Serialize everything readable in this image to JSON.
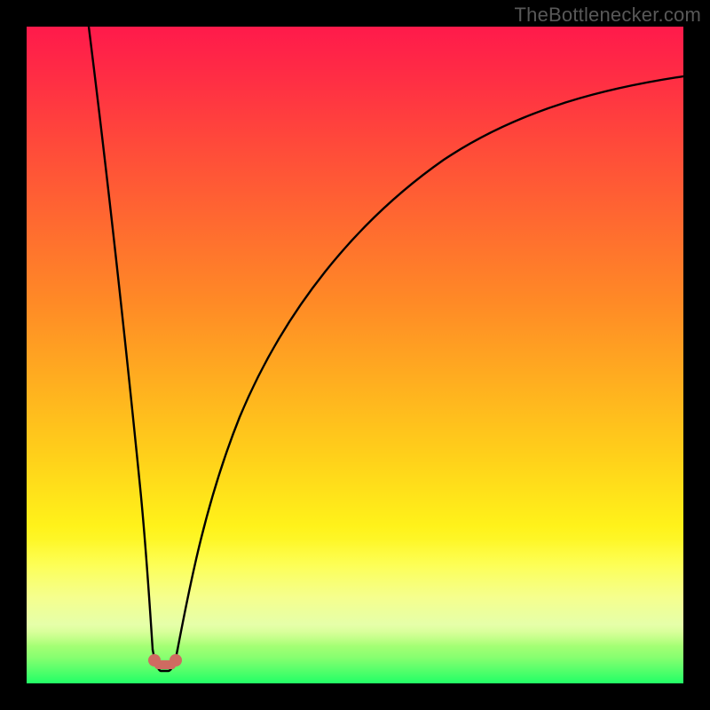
{
  "watermark": {
    "text": "TheBottlenecker.com"
  },
  "chart_data": {
    "type": "line",
    "title": "",
    "xlabel": "",
    "ylabel": "",
    "xlim": [
      0,
      100
    ],
    "ylim": [
      0,
      100
    ],
    "legend": false,
    "grid": false,
    "annotations": [],
    "background_gradient": {
      "direction": "vertical",
      "stops": [
        {
          "pct": 0,
          "color": "#ff1a4b"
        },
        {
          "pct": 50,
          "color": "#ffa81f"
        },
        {
          "pct": 78,
          "color": "#fff21a"
        },
        {
          "pct": 100,
          "color": "#22ff66"
        }
      ]
    },
    "curve": {
      "description": "V / cusp shaped bottleneck curve; minimum near x≈20 at y≈0",
      "min_x": 20,
      "min_y": 0,
      "points": [
        {
          "x": 9.5,
          "y": 100
        },
        {
          "x": 12,
          "y": 75
        },
        {
          "x": 14,
          "y": 55
        },
        {
          "x": 16,
          "y": 35
        },
        {
          "x": 17.5,
          "y": 18
        },
        {
          "x": 18.7,
          "y": 6
        },
        {
          "x": 19.5,
          "y": 1.5
        },
        {
          "x": 20.5,
          "y": 0.8
        },
        {
          "x": 21.8,
          "y": 1.5
        },
        {
          "x": 23,
          "y": 6
        },
        {
          "x": 26,
          "y": 20
        },
        {
          "x": 30,
          "y": 36
        },
        {
          "x": 36,
          "y": 52
        },
        {
          "x": 44,
          "y": 65
        },
        {
          "x": 54,
          "y": 75
        },
        {
          "x": 66,
          "y": 82
        },
        {
          "x": 80,
          "y": 87.5
        },
        {
          "x": 100,
          "y": 92
        }
      ]
    },
    "markers": {
      "color": "#cf6b61",
      "radius_px": 7,
      "positions": [
        {
          "x": 19.0,
          "y": 2.2
        },
        {
          "x": 22.2,
          "y": 2.2
        }
      ]
    }
  }
}
